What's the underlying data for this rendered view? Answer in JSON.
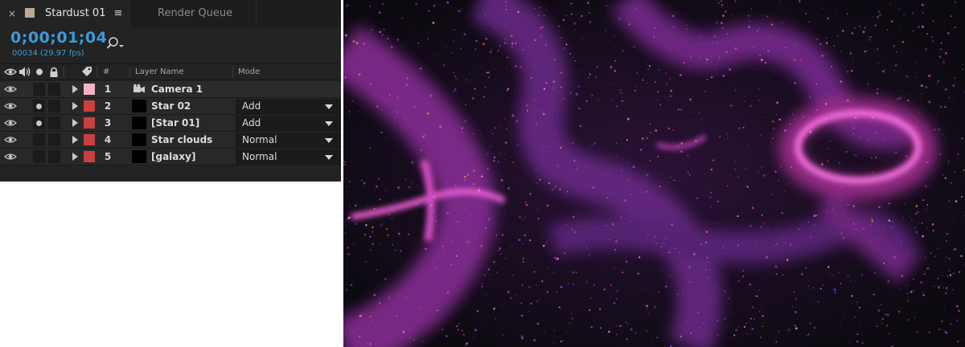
{
  "tabs": [
    {
      "label": "Stardust 01",
      "active": true
    },
    {
      "label": "Render Queue",
      "active": false
    }
  ],
  "tab_close_glyph": "×",
  "tab_menu_glyph": "≡",
  "comp_swatch_color": "#b9a98f",
  "timecode": "0;00;01;04",
  "frame_info": "00034 (29.97 fps)",
  "columns": {
    "number": "#",
    "layer_name": "Layer Name",
    "mode": "Mode"
  },
  "header_icons": [
    "eye-icon",
    "speaker-icon",
    "solo-dot-icon",
    "lock-icon",
    "label-tag-icon"
  ],
  "layers": [
    {
      "number": "1",
      "name": "Camera 1",
      "mode": "",
      "label_color": "#f0b6c4",
      "solo": false,
      "type": "camera"
    },
    {
      "number": "2",
      "name": "Star 02",
      "mode": "Add",
      "label_color": "#c9403f",
      "solo": true,
      "type": "solid"
    },
    {
      "number": "3",
      "name": "[Star 01]",
      "mode": "Add",
      "label_color": "#c9403f",
      "solo": true,
      "type": "solid"
    },
    {
      "number": "4",
      "name": "Star clouds",
      "mode": "Normal",
      "label_color": "#c9403f",
      "solo": false,
      "type": "solid"
    },
    {
      "number": "5",
      "name": "[galaxy]",
      "mode": "Normal",
      "label_color": "#c9403f",
      "solo": false,
      "type": "solid"
    }
  ],
  "colors": {
    "accent_blue": "#3b9bd8",
    "particle_magenta": "#e040c8",
    "particle_purple": "#6a34b0",
    "particle_orange": "#e07a3a"
  }
}
